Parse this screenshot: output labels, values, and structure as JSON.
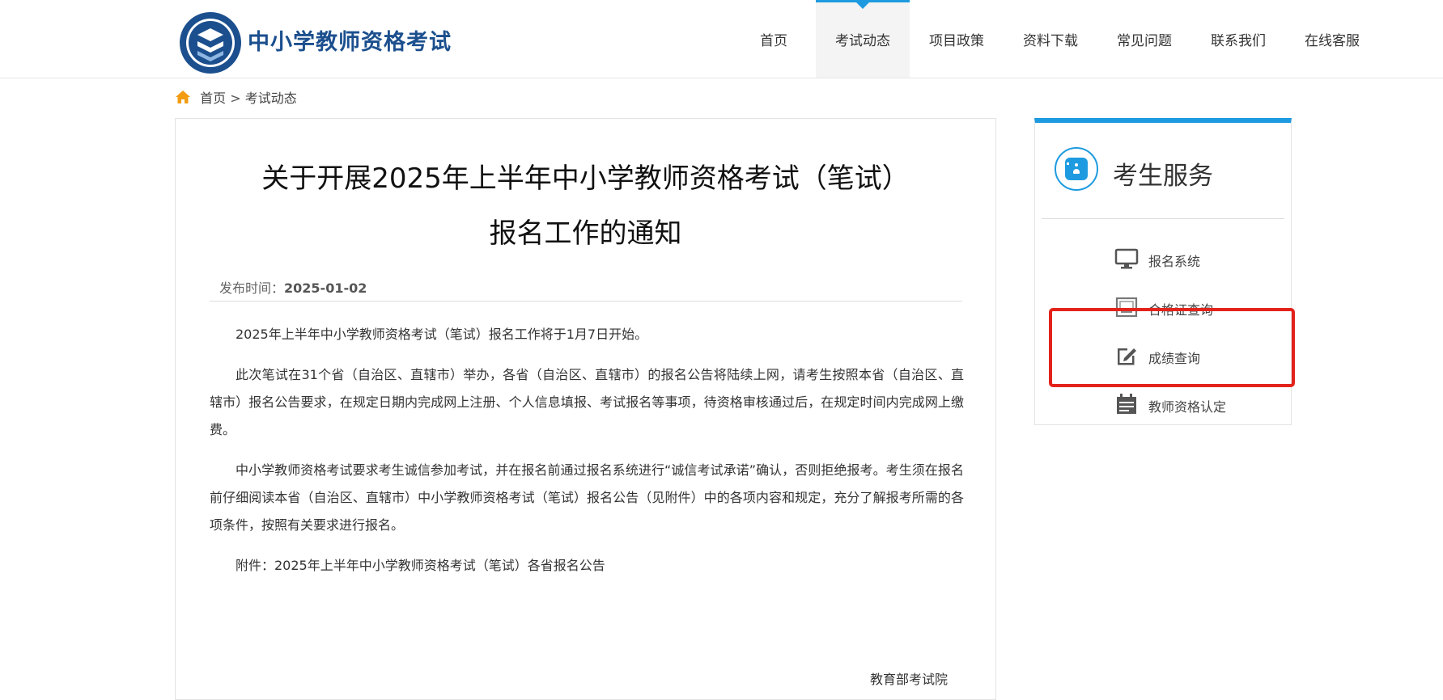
{
  "header": {
    "site_title": "中小学教师资格考试",
    "nav": [
      "首页",
      "考试动态",
      "项目政策",
      "资料下载",
      "常见问题",
      "联系我们",
      "在线客服"
    ],
    "active_nav": "考试动态"
  },
  "breadcrumb": {
    "home": "首页",
    "separator": ">",
    "current": "考试动态"
  },
  "article": {
    "title_line1": "关于开展2025年上半年中小学教师资格考试（笔试）",
    "title_line2": "报名工作的通知",
    "date_label": "发布时间：",
    "date": "2025-01-02",
    "paragraphs": [
      "2025年上半年中小学教师资格考试（笔试）报名工作将于1月7日开始。",
      "此次笔试在31个省（自治区、直辖市）举办，各省（自治区、直辖市）的报名公告将陆续上网，请考生按照本省（自治区、直辖市）报名公告要求，在规定日期内完成网上注册、个人信息填报、考试报名等事项，待资格审核通过后，在规定时间内完成网上缴费。",
      "中小学教师资格考试要求考生诚信参加考试，并在报名前通过报名系统进行“诚信考试承诺”确认，否则拒绝报考。考生须在报名前仔细阅读本省（自治区、直辖市）中小学教师资格考试（笔试）报名公告（见附件）中的各项内容和规定，充分了解报考所需的各项条件，按照有关要求进行报名。",
      "附件：2025年上半年中小学教师资格考试（笔试）各省报名公告"
    ],
    "signature": "教育部考试院"
  },
  "sidebar": {
    "title": "考生服务",
    "items": [
      {
        "label": "报名系统",
        "icon": "monitor-icon"
      },
      {
        "label": "合格证查询",
        "icon": "certificate-icon"
      },
      {
        "label": "成绩查询",
        "icon": "edit-icon"
      },
      {
        "label": "教师资格认定",
        "icon": "calendar-icon"
      }
    ]
  },
  "colors": {
    "accent": "#1e9be0",
    "brand": "#1c4f8e",
    "highlight": "#e3231b"
  }
}
